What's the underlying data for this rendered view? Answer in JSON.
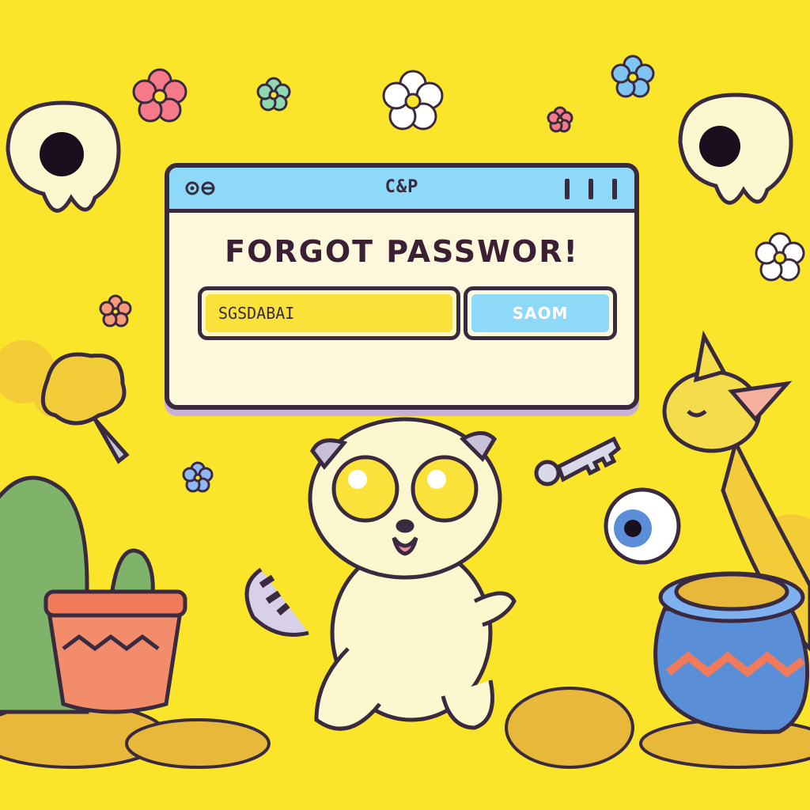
{
  "window": {
    "title": "C&P",
    "heading": "FORGOT PASSWOR!",
    "input_value": "SGSDABAI",
    "submit_label": "SAOM"
  },
  "icons": {
    "title_left": "eye-toggle-icon",
    "title_right": "window-controls-icon"
  },
  "colors": {
    "background": "#fbe52a",
    "titlebar": "#8fd9f8",
    "input_fill": "#fbe23a",
    "outline": "#3a2a40"
  }
}
